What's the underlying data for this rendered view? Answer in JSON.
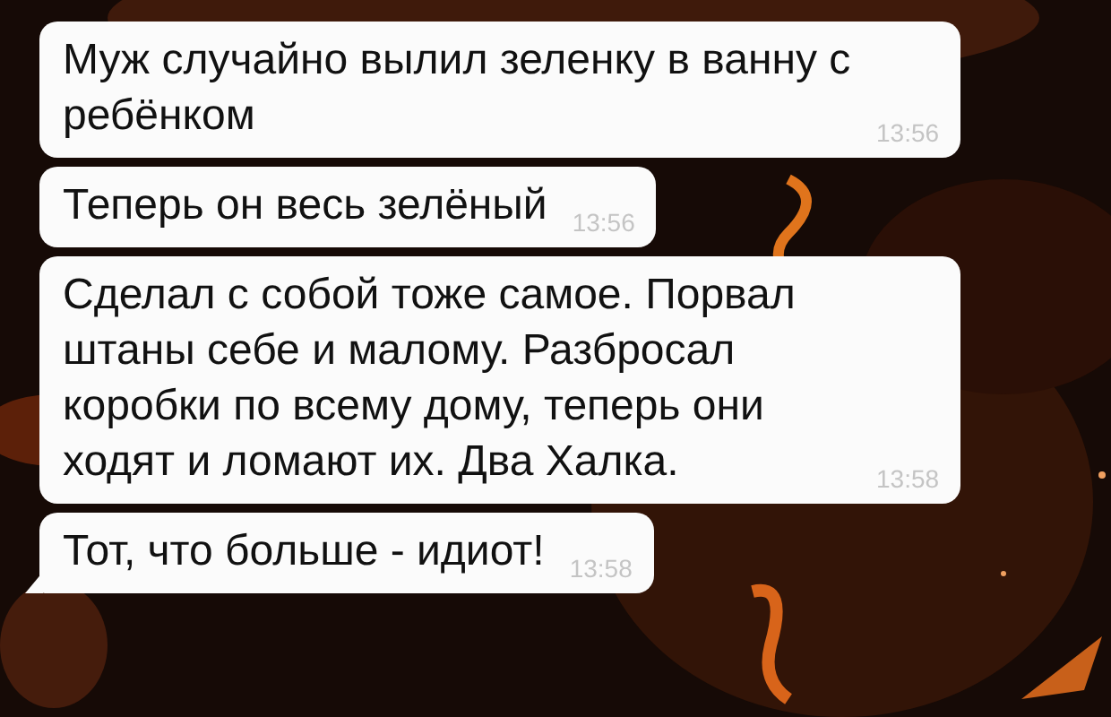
{
  "messages": [
    {
      "text": "Муж случайно вылил зеленку в ванну с ребёнком",
      "time": "13:56",
      "tail": false
    },
    {
      "text": "Теперь он весь зелёный",
      "time": "13:56",
      "tail": false
    },
    {
      "text": "Сделал с собой тоже самое. Порвал штаны себе и малому. Разбросал коробки по всему дому, теперь они ходят и ломают их. Два Халка.",
      "time": "13:58",
      "tail": false
    },
    {
      "text": "Тот, что больше - идиот!",
      "time": "13:58",
      "tail": true
    }
  ]
}
